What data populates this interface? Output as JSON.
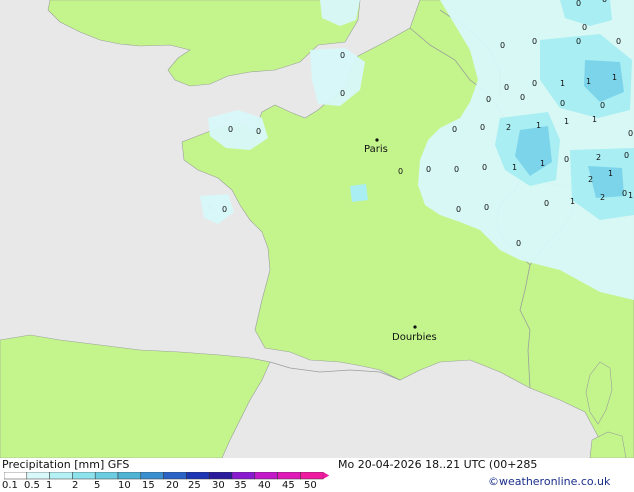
{
  "map": {
    "cities": [
      {
        "name": "Paris"
      },
      {
        "name": "Dourbies"
      }
    ],
    "precip_values": [
      "0",
      "0",
      "0",
      "0",
      "0",
      "0",
      "0",
      "0",
      "0",
      "0",
      "0",
      "0",
      "0",
      "0",
      "0",
      "0",
      "0",
      "0",
      "0",
      "0",
      "0",
      "0",
      "0",
      "0",
      "0",
      "0",
      "0",
      "1",
      "1",
      "1",
      "2",
      "1",
      "1",
      "1",
      "1",
      "2",
      "1",
      "1",
      "2",
      "1",
      "2",
      "1",
      "0",
      "0",
      "0",
      "0",
      "0"
    ]
  },
  "footer": {
    "title": "Precipitation [mm]",
    "model": "GFS",
    "datetime": "Mo 20-04-2026 18..21 UTC (00+285",
    "credit": "©weatheronline.co.uk",
    "legend_labels": [
      "0.1",
      "0.5",
      "1",
      "2",
      "5",
      "10",
      "15",
      "20",
      "25",
      "30",
      "35",
      "40",
      "45",
      "50"
    ],
    "legend_colors": [
      "#ffffff",
      "#d8f8fa",
      "#b4f0f4",
      "#8ee2ec",
      "#6ccde0",
      "#4fb3d4",
      "#3a8fd0",
      "#2b62c6",
      "#1c36b4",
      "#2a1a9c",
      "#8a1ad0",
      "#c21ac8",
      "#e01ab8",
      "#f01aa0"
    ]
  },
  "colors": {
    "sea": "#e8e8e8",
    "land": "#c4f58c",
    "light_precip": "#d8f8fa",
    "moderate_precip": "#a8eef2",
    "heavier_precip": "#7cd4ea",
    "border": "#9aa09a"
  }
}
